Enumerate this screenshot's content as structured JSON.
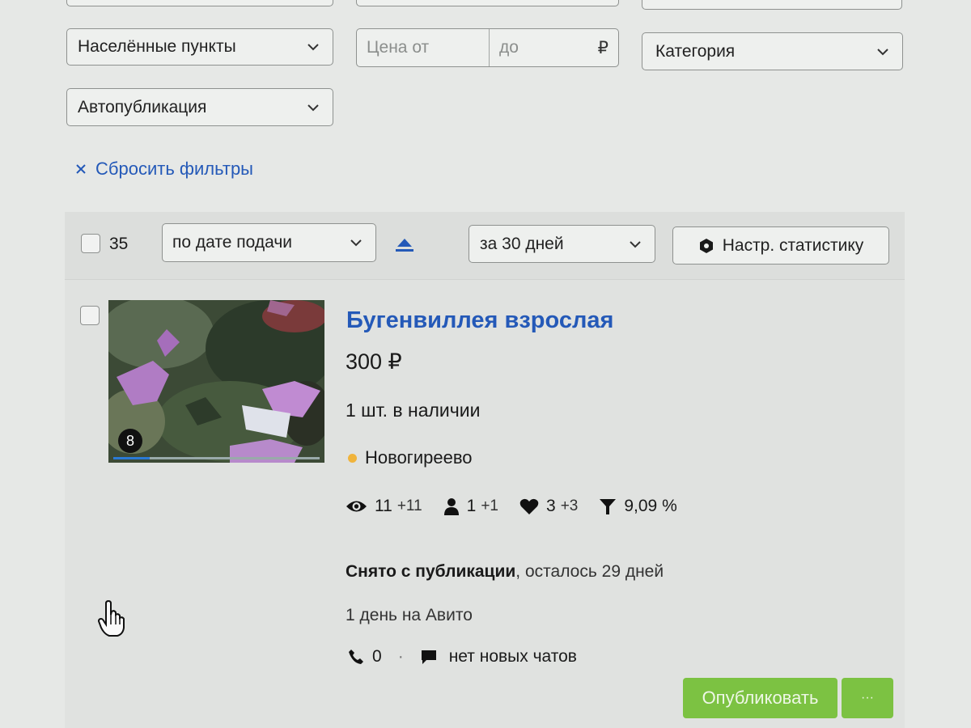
{
  "filters": {
    "settlements_label": "Населённые пункты",
    "price_from_placeholder": "Цена от",
    "price_to_placeholder": "до",
    "currency": "₽",
    "category_label": "Категория",
    "autopublish_label": "Автопубликация",
    "reset_label": "Сбросить фильтры"
  },
  "listbar": {
    "count": "35",
    "sort_label": "по дате подачи",
    "period_label": "за 30 дней",
    "stats_settings_label": "Настр. статистику"
  },
  "listing": {
    "photo_count": "8",
    "title": "Бугенвиллея взрослая",
    "price": "300 ₽",
    "stock": "1 шт. в наличии",
    "location": "Новогиреево",
    "location_dot_color": "#f0b43c",
    "stats": {
      "views": "11",
      "views_delta": "+11",
      "contacts": "1",
      "contacts_delta": "+1",
      "favorites": "3",
      "favorites_delta": "+3",
      "conversion": "9,09 %"
    },
    "status_bold": "Снято с публикации",
    "status_rest": ", осталось 29 дней",
    "age": "1 день на Авито",
    "calls": "0",
    "separator": "·",
    "chats": "нет новых чатов",
    "publish_button": "Опубликовать",
    "more_button": "···"
  },
  "colors": {
    "accent_blue": "#2459b8",
    "publish_green": "#7cc242"
  }
}
